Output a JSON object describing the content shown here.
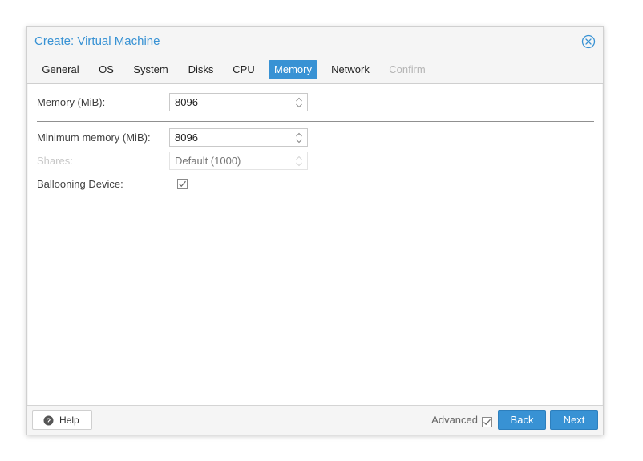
{
  "window": {
    "title": "Create: Virtual Machine"
  },
  "tabs": [
    {
      "label": "General",
      "state": "normal"
    },
    {
      "label": "OS",
      "state": "normal"
    },
    {
      "label": "System",
      "state": "normal"
    },
    {
      "label": "Disks",
      "state": "normal"
    },
    {
      "label": "CPU",
      "state": "normal"
    },
    {
      "label": "Memory",
      "state": "active"
    },
    {
      "label": "Network",
      "state": "normal"
    },
    {
      "label": "Confirm",
      "state": "disabled"
    }
  ],
  "form": {
    "memory": {
      "label": "Memory (MiB):",
      "value": "8096"
    },
    "minimum_memory": {
      "label": "Minimum memory (MiB):",
      "value": "8096"
    },
    "shares": {
      "label": "Shares:",
      "placeholder": "Default (1000)",
      "disabled": true
    },
    "ballooning": {
      "label": "Ballooning Device:",
      "checked": true
    }
  },
  "footer": {
    "help_label": "Help",
    "advanced_label": "Advanced",
    "advanced_checked": true,
    "back_label": "Back",
    "next_label": "Next"
  },
  "icons": {
    "close": "close-circle-icon",
    "help": "question-circle-icon",
    "spinner": "chevron-up-down-icon",
    "check": "checkmark-icon"
  },
  "colors": {
    "accent": "#3892d4",
    "title": "#3892d4",
    "disabled_text": "#b4b4b4"
  }
}
